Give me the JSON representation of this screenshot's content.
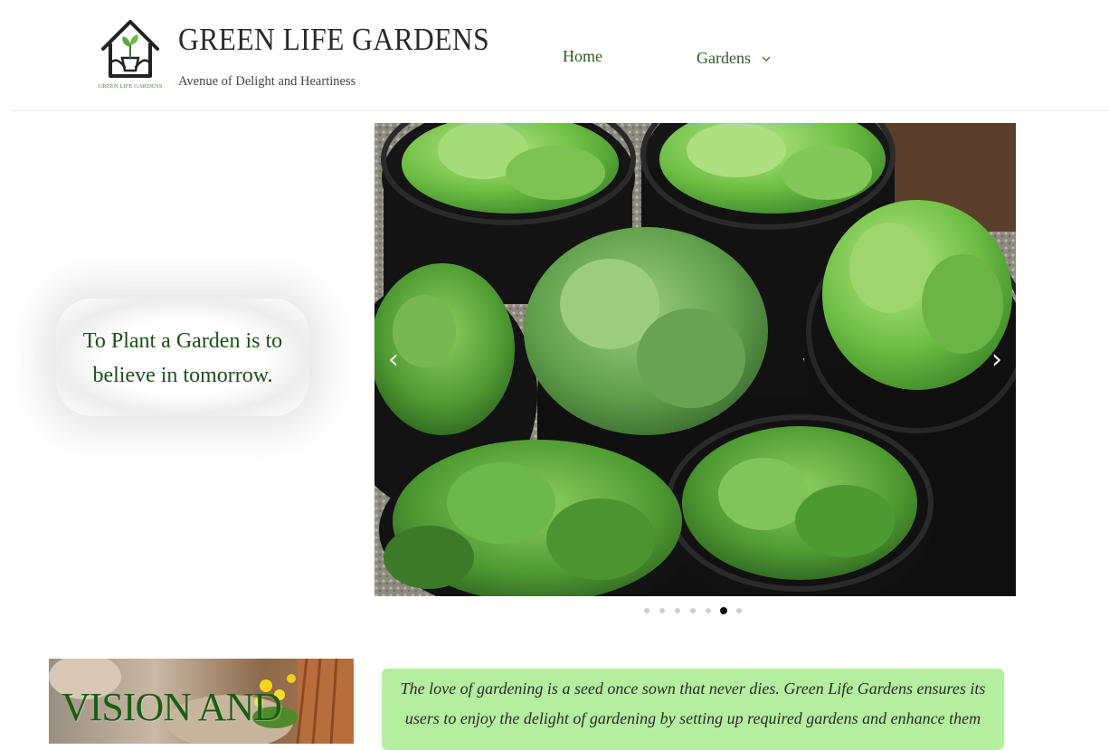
{
  "header": {
    "logo_caption": "GREEN LIFE GARDENS",
    "title": "GREEN LIFE GARDENS",
    "tagline": "Avenue of Delight and Heartiness",
    "nav": {
      "home": "Home",
      "gardens": "Gardens"
    }
  },
  "hero": {
    "quote": "To Plant a Garden is to believe in tomorrow."
  },
  "carousel": {
    "image": "potted-lettuce-and-greens",
    "slide_count": 7,
    "active_slide": 6,
    "prev": "‹",
    "next": "›"
  },
  "vision": {
    "title": "VISION AND"
  },
  "intro": {
    "text": "The love of gardening is a seed once sown that never dies. Green Life Gardens ensures its users to enjoy the delight of gardening by setting up required gardens and enhance them"
  },
  "colors": {
    "accent_green": "#2f5a1f",
    "intro_bg": "#b4ef9f",
    "vision_green": "#1b5e12"
  }
}
